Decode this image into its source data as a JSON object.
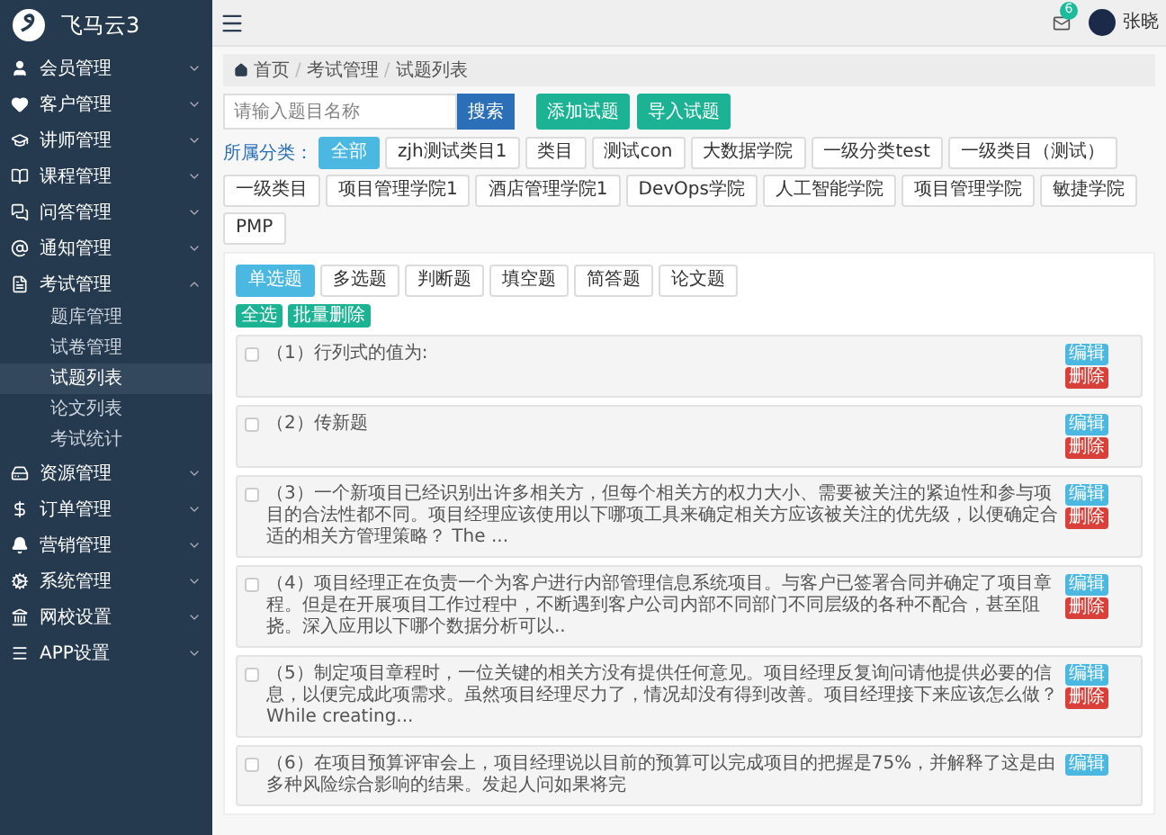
{
  "sidebar": {
    "logo": "飞马云3",
    "items": [
      {
        "label": "会员管理",
        "expanded": false
      },
      {
        "label": "客户管理",
        "expanded": false
      },
      {
        "label": "讲师管理",
        "expanded": false
      },
      {
        "label": "课程管理",
        "expanded": false
      },
      {
        "label": "问答管理",
        "expanded": false
      },
      {
        "label": "通知管理",
        "expanded": false
      },
      {
        "label": "考试管理",
        "expanded": true,
        "children": [
          {
            "label": "题库管理",
            "selected": false
          },
          {
            "label": "试卷管理",
            "selected": false
          },
          {
            "label": "试题列表",
            "selected": true
          },
          {
            "label": "论文列表",
            "selected": false
          },
          {
            "label": "考试统计",
            "selected": false
          }
        ]
      },
      {
        "label": "资源管理",
        "expanded": false
      },
      {
        "label": "订单管理",
        "expanded": false
      },
      {
        "label": "营销管理",
        "expanded": false
      },
      {
        "label": "系统管理",
        "expanded": false
      },
      {
        "label": "网校设置",
        "expanded": false
      },
      {
        "label": "APP设置",
        "expanded": false
      }
    ]
  },
  "header": {
    "mail_badge": "6",
    "user_name": "张晓"
  },
  "breadcrumb": [
    {
      "kind": "link",
      "text": "首页"
    },
    {
      "kind": "separator",
      "text": "/"
    },
    {
      "kind": "link",
      "text": "考试管理"
    },
    {
      "kind": "separator",
      "text": "/"
    },
    {
      "kind": "link",
      "text": "试题列表"
    }
  ],
  "search": {
    "placeholder": "请输入题目名称",
    "button": "搜索"
  },
  "actions": [
    "添加试题",
    "导入试题"
  ],
  "categories": {
    "label": "所属分类：",
    "items": [
      {
        "label": "全部",
        "selected": true
      },
      {
        "label": "zjh测试类目1",
        "selected": false
      },
      {
        "label": "类目",
        "selected": false
      },
      {
        "label": "测试con",
        "selected": false
      },
      {
        "label": "大数据学院",
        "selected": false
      },
      {
        "label": "一级分类test",
        "selected": false
      },
      {
        "label": "一级类目（测试）",
        "selected": false
      },
      {
        "label": "一级类目",
        "selected": false
      },
      {
        "label": "项目管理学院1",
        "selected": false
      },
      {
        "label": "酒店管理学院1",
        "selected": false
      },
      {
        "label": "DevOps学院",
        "selected": false
      },
      {
        "label": "人工智能学院",
        "selected": false
      },
      {
        "label": "项目管理学院",
        "selected": false
      },
      {
        "label": "敏捷学院",
        "selected": false
      },
      {
        "label": "PMP",
        "selected": false
      }
    ]
  },
  "question_types": [
    {
      "label": "单选题",
      "selected": true
    },
    {
      "label": "多选题",
      "selected": false
    },
    {
      "label": "判断题",
      "selected": false
    },
    {
      "label": "填空题",
      "selected": false
    },
    {
      "label": "简答题",
      "selected": false
    },
    {
      "label": "论文题",
      "selected": false
    }
  ],
  "bulk_actions": [
    "全选",
    "批量删除"
  ],
  "questions": [
    {
      "text": "（1）行列式的值为:",
      "checked": false,
      "edit": "编辑",
      "delete": "删除"
    },
    {
      "text": "（2）传新题",
      "checked": false,
      "edit": "编辑",
      "delete": "删除"
    },
    {
      "text": "（3）一个新项目已经识别出许多相关方，但每个相关方的权力大小、需要被关注的紧迫性和参与项目的合法性都不同。项目经理应该使用以下哪项工具来确定相关方应该被关注的优先级，以便确定合适的相关方管理策略？ The ...",
      "checked": false,
      "edit": "编辑",
      "delete": "删除"
    },
    {
      "text": "（4）项目经理正在负责一个为客户进行内部管理信息系统项目。与客户已签署合同并确定了项目章程。但是在开展项目工作过程中，不断遇到客户公司内部不同部门不同层级的各种不配合，甚至阻挠。深入应用以下哪个数据分析可以..",
      "checked": false,
      "edit": "编辑",
      "delete": "删除"
    },
    {
      "text": "（5）制定项目章程时，一位关键的相关方没有提供任何意见。项目经理反复询问请他提供必要的信息，以便完成此项需求。虽然项目经理尽力了，情况却没有得到改善。项目经理接下来应该怎么做？ While creating...",
      "checked": false,
      "edit": "编辑",
      "delete": "删除"
    },
    {
      "text": "（6）在项目预算评审会上，项目经理说以目前的预算可以完成项目的把握是75%，并解释了这是由多种风险综合影响的结果。发起人问如果将完",
      "checked": false,
      "edit": "编辑"
    }
  ]
}
